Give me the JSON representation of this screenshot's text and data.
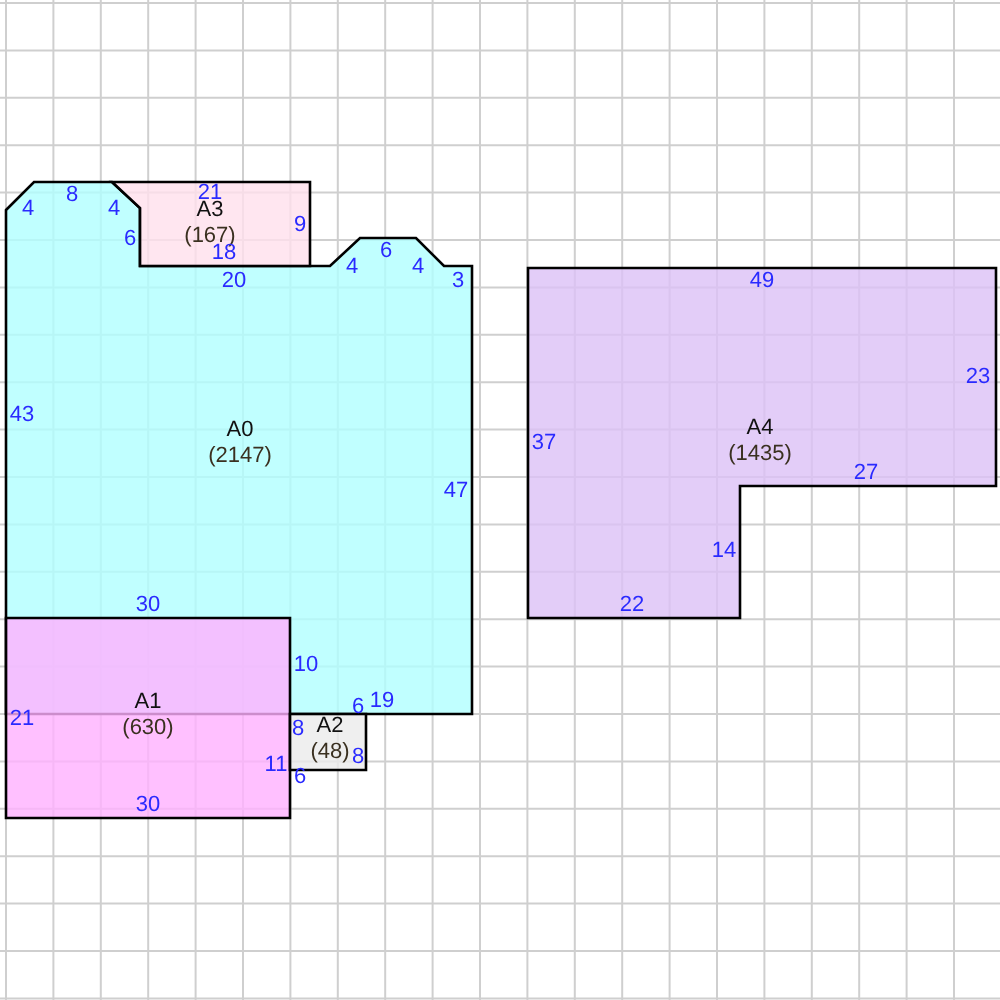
{
  "areas": [
    {
      "name": "A0",
      "size": "(2147)",
      "color": "#b0ffff",
      "edges": [
        "4",
        "8",
        "4",
        "6",
        "20",
        "4",
        "6",
        "4",
        "3",
        "47",
        "19",
        "6",
        "10",
        "30",
        "43"
      ]
    },
    {
      "name": "A1",
      "size": "(630)",
      "color": "#ffb0ff",
      "edges": [
        "21",
        "30",
        "11"
      ]
    },
    {
      "name": "A2",
      "size": "(48)",
      "color": "#ebebeb",
      "edges": [
        "8",
        "8",
        "6"
      ]
    },
    {
      "name": "A3",
      "size": "(167)",
      "color": "#ffe0ec",
      "edges": [
        "21",
        "9",
        "18"
      ]
    },
    {
      "name": "A4",
      "size": "(1435)",
      "color": "#dcc0f6",
      "edges": [
        "49",
        "23",
        "27",
        "14",
        "22",
        "37"
      ]
    }
  ]
}
